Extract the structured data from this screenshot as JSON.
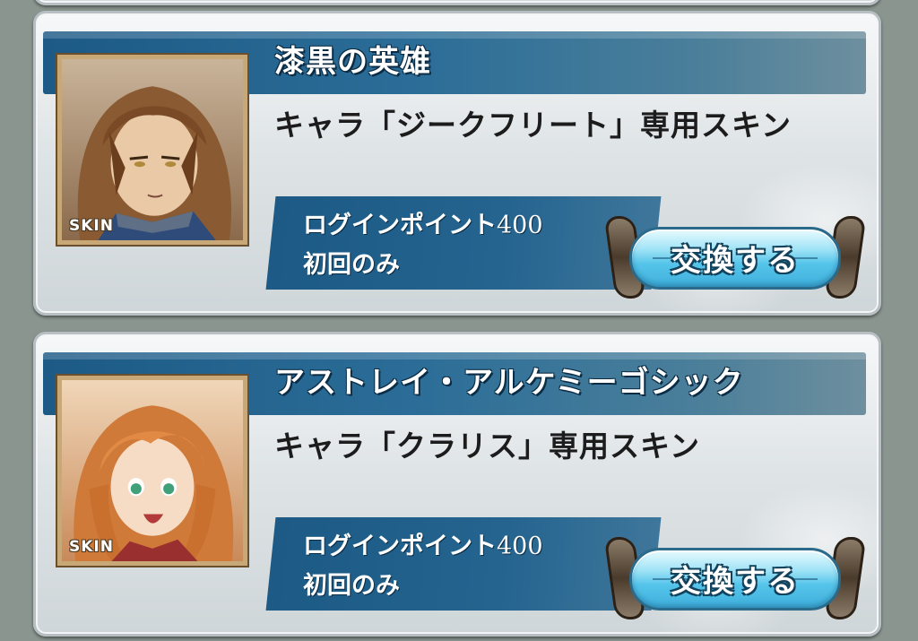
{
  "items": [
    {
      "title": "漆黒の英雄",
      "description": "キャラ「ジークフリート」専用スキン",
      "badge": "SKIN",
      "cost_label": "ログインポイント",
      "cost_value": "400",
      "limit": "初回のみ",
      "button_label": "交換する",
      "portrait_icon": "siegfried-skin-portrait"
    },
    {
      "title": "アストレイ・アルケミーゴシック",
      "description": "キャラ「クラリス」専用スキン",
      "badge": "SKIN",
      "cost_label": "ログインポイント",
      "cost_value": "400",
      "limit": "初回のみ",
      "button_label": "交換する",
      "portrait_icon": "clarisse-skin-portrait"
    }
  ],
  "colors": {
    "title_bar": "#1d5a86",
    "button_fill": "#55c4ea",
    "card_bg": "#dfe4e6",
    "frame_gold": "#c9a877"
  }
}
